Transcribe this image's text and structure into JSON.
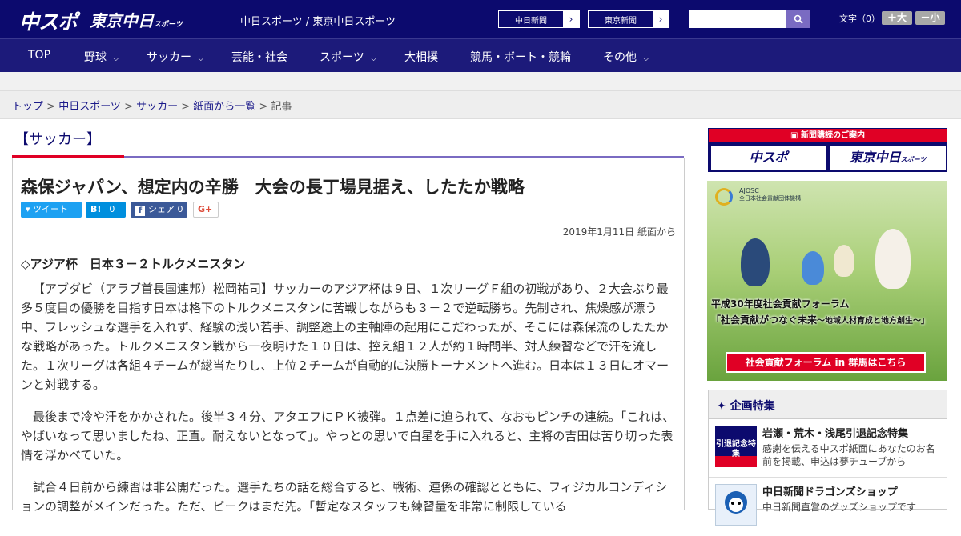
{
  "header": {
    "logo_main": "中スポ",
    "logo_sub": "東京中日",
    "logo_sub_small": "スポーツ",
    "site_name": "中日スポーツ / 東京中日スポーツ",
    "paper_links": [
      "中日新聞",
      "東京新聞"
    ],
    "arrow": "›",
    "search_placeholder": "",
    "search_icon": "search-icon",
    "font_size_label": "文字（0）",
    "font_up": "＋大",
    "font_down": "－小"
  },
  "nav": {
    "items": [
      {
        "label": "TOP",
        "has_menu": false
      },
      {
        "label": "野球",
        "has_menu": true
      },
      {
        "label": "サッカー",
        "has_menu": true
      },
      {
        "label": "芸能・社会",
        "has_menu": false
      },
      {
        "label": "スポーツ",
        "has_menu": true
      },
      {
        "label": "大相撲",
        "has_menu": false
      },
      {
        "label": "競馬・ボート・競輪",
        "has_menu": false
      },
      {
        "label": "その他",
        "has_menu": true
      }
    ],
    "chevron": "⌵"
  },
  "breadcrumb": {
    "items": [
      "トップ",
      "中日スポーツ",
      "サッカー",
      "紙面から一覧"
    ],
    "current": "記事",
    "sep": " > "
  },
  "category": "【サッカー】",
  "article": {
    "title": "森保ジャパン、想定内の辛勝　大会の長丁場見据え、したたか戦略",
    "share": {
      "tweet": "ツイート",
      "hatena": "B!",
      "hatena_count": "0",
      "facebook": "シェア",
      "facebook_count": "0",
      "gplus": "G+"
    },
    "date": "2019年1月11日 紙面から",
    "subtitle": "◇アジア杯　日本３－２トルクメニスタン",
    "paragraphs": [
      "【アブダビ（アラブ首長国連邦）松岡祐司】サッカーのアジア杯は９日、１次リーグＦ組の初戦があり、２大会ぶり最多５度目の優勝を目指す日本は格下のトルクメニスタンに苦戦しながらも３－２で逆転勝ち。先制され、焦燥感が漂う中、フレッシュな選手を入れず、経験の浅い若手、調整途上の主軸陣の起用にこだわったが、そこには森保流のしたたかな戦略があった。トルクメニスタン戦から一夜明けた１０日は、控え組１２人が約１時間半、対人練習などで汗を流した。１次リーグは各組４チームが総当たりし、上位２チームが自動的に決勝トーナメントへ進む。日本は１３日にオマーンと対戦する。",
      "最後まで冷や汗をかかされた。後半３４分、アタエフにＰＫ被弾。１点差に迫られて、なおもピンチの連続。「これは、やばいなって思いましたね、正直。耐えないとなって」。やっとの思いで白星を手に入れると、主将の吉田は苦り切った表情を浮かべていた。",
      "試合４日前から練習は非公開だった。選手たちの話を総合すると、戦術、連係の確認とともに、フィジカルコンディションの調整がメインだった。ただ、ピークはまだ先。「暫定なスタッフも練習量を非常に制限している"
    ]
  },
  "sidebar": {
    "subscribe_header": "新聞購読のご案内",
    "subscribe_links": [
      "中スポ",
      "東京中日"
    ],
    "subscribe_small": "スポーツ",
    "ad": {
      "org": "AJOSC",
      "org_sub": "全日本社会貢献団体機構",
      "line1": "平成30年度社会貢献フォーラム",
      "line2": "「社会貢献がつなぐ未来",
      "line2_small": "～地域人材育成と地方創生～」",
      "cta": "社会貢献フォーラム in 群馬はこちら"
    },
    "feature_header": "企画特集",
    "features": [
      {
        "title": "岩瀬・荒木・浅尾引退記念特集",
        "desc": "感謝を伝える中スポ紙面にあなたのお名前を掲載、申込は夢チューブから",
        "thumb": "引退記念特集"
      },
      {
        "title": "中日新聞ドラゴンズショップ",
        "desc": "中日新聞直営のグッズショップです",
        "thumb": ""
      }
    ]
  },
  "colors": {
    "header": "#0c0a6e",
    "nav": "#1c1a7a",
    "accent_red": "#e00025",
    "accent_purple": "#7a6bc2"
  }
}
